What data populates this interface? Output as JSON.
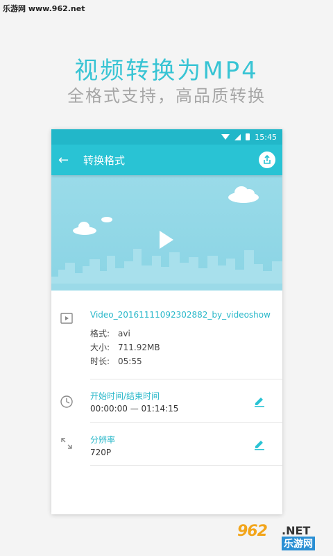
{
  "watermark_top": "乐游网 www.962.net",
  "promo": {
    "title": "视频转换为MP4",
    "subtitle": "全格式支持，高品质转换"
  },
  "statusbar": {
    "time": "15:45"
  },
  "appbar": {
    "title": "转换格式",
    "back_icon": "arrow-left-icon",
    "share_icon": "share-icon"
  },
  "file": {
    "name": "Video_20161111092302882_by_videoshow",
    "format_label": "格式:",
    "format_value": "avi",
    "size_label": "大小:",
    "size_value": "711.92MB",
    "duration_label": "时长:",
    "duration_value": "05:55"
  },
  "time_range": {
    "label": "开始时间/结束时间",
    "value": "00:00:00 — 01:14:15"
  },
  "resolution": {
    "label": "分辨率",
    "value": "720P"
  },
  "logo": {
    "num": "962",
    "net": ".NET",
    "cn": "乐游网"
  },
  "colors": {
    "accent": "#29c3d4",
    "title": "#38c4d4",
    "sub": "#a6a6a6"
  }
}
